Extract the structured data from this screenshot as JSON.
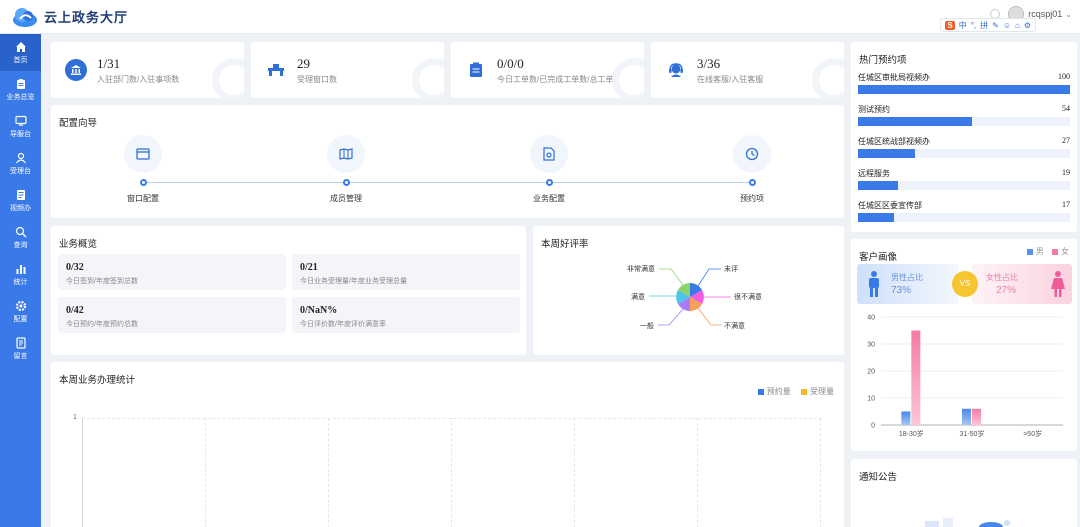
{
  "app": {
    "title": "云上政务大厅"
  },
  "header": {
    "username": "rcqspj01"
  },
  "ime": {
    "items": [
      "S",
      "中",
      "°,",
      "拼",
      "✎",
      "☺",
      "⌂",
      "⚙"
    ]
  },
  "sidebar": {
    "items": [
      {
        "label": "首页",
        "icon": "home-icon",
        "active": true
      },
      {
        "label": "业务总览",
        "icon": "clipboard-icon",
        "active": false
      },
      {
        "label": "导服台",
        "icon": "monitor-icon",
        "active": false
      },
      {
        "label": "受理台",
        "icon": "user-icon",
        "active": false
      },
      {
        "label": "视频办",
        "icon": "document-icon",
        "active": false
      },
      {
        "label": "查询",
        "icon": "search-icon",
        "active": false
      },
      {
        "label": "统计",
        "icon": "bar-chart-icon",
        "active": false
      },
      {
        "label": "配置",
        "icon": "gear-icon",
        "active": false
      },
      {
        "label": "留言",
        "icon": "message-icon",
        "active": false
      }
    ]
  },
  "stats": [
    {
      "value": "1/31",
      "label": "入驻部门数/入驻事项数",
      "icon": "bank-icon"
    },
    {
      "value": "29",
      "label": "受理窗口数",
      "icon": "counter-icon"
    },
    {
      "value": "0/0/0",
      "label": "今日工单数/已完成工单数/总工单",
      "icon": "ticket-icon"
    },
    {
      "value": "3/36",
      "label": "在线客服/入驻客服",
      "icon": "agent-icon"
    }
  ],
  "guide": {
    "title": "配置向导",
    "steps": [
      {
        "label": "窗口配置",
        "icon": "window-icon"
      },
      {
        "label": "成员管理",
        "icon": "map-icon"
      },
      {
        "label": "业务配置",
        "icon": "settings-doc-icon"
      },
      {
        "label": "预约项",
        "icon": "clock-icon"
      }
    ]
  },
  "overview": {
    "title": "业务概览",
    "items": [
      {
        "value": "0/32",
        "desc": "今日签到/年度签到总数"
      },
      {
        "value": "0/21",
        "desc": "今日业务受理量/年度业务受理总量"
      },
      {
        "value": "0/42",
        "desc": "今日预约/年度预约总数"
      },
      {
        "value": "0/NaN%",
        "desc": "今日评价数/年度评价满意率"
      }
    ]
  },
  "rating": {
    "title": "本周好评率",
    "labels": {
      "very_satisfied": "非常满意",
      "satisfied": "满意",
      "normal": "一般",
      "unrated": "未评",
      "very_unsatisfied": "很不满意",
      "unsatisfied": "不满意"
    }
  },
  "weekly": {
    "title": "本周业务办理统计",
    "legend": [
      {
        "name": "预约量",
        "color": "#3a79e8"
      },
      {
        "name": "受理量",
        "color": "#f5b92b"
      }
    ],
    "y_tick": "1"
  },
  "hot": {
    "title": "热门预约项",
    "items": [
      {
        "name": "任城区审批局视频办",
        "count": 100
      },
      {
        "name": "测试预约",
        "count": 54
      },
      {
        "name": "任城区统战部视频办",
        "count": 27
      },
      {
        "name": "远程服务",
        "count": 19
      },
      {
        "name": "任城区区委宣传部",
        "count": 17
      }
    ],
    "max": 100
  },
  "portrait": {
    "title": "客户画像",
    "legend_male": "男",
    "legend_female": "女",
    "male_label": "男性占比",
    "male_value": "73%",
    "vs": "VS",
    "female_label": "女性占比",
    "female_value": "27%"
  },
  "chart_data": {
    "type": "bar",
    "categories": [
      "18-30岁",
      "31-50岁",
      ">50岁"
    ],
    "series": [
      {
        "name": "男",
        "values": [
          5,
          6,
          0
        ]
      },
      {
        "name": "女",
        "values": [
          35,
          6,
          0
        ]
      }
    ],
    "ylim": [
      0,
      40
    ],
    "yticks": [
      "0",
      "10",
      "20",
      "30",
      "40"
    ],
    "grid": true,
    "legend": "top-right"
  },
  "notice": {
    "title": "通知公告"
  }
}
